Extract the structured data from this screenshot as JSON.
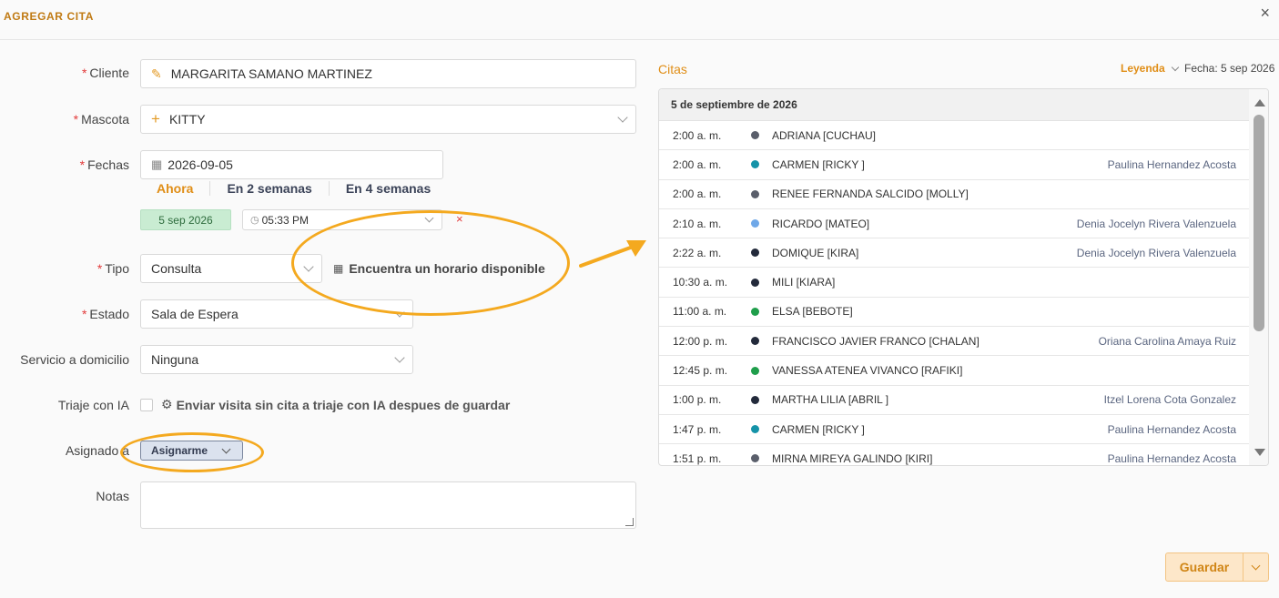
{
  "dialog": {
    "title": "AGREGAR CITA",
    "close_glyph": "×"
  },
  "form": {
    "cliente": {
      "label": "Cliente",
      "required": "*",
      "value": "MARGARITA SAMANO MARTINEZ",
      "icon": "edit-icon"
    },
    "mascota": {
      "label": "Mascota",
      "required": "*",
      "value": "KITTY",
      "icon": "plus-icon"
    },
    "fechas": {
      "label": "Fechas",
      "required": "*",
      "value": "2026-09-05",
      "quick": [
        "Ahora",
        "En 2 semanas",
        "En 4 semanas"
      ],
      "date_badge": "5 sep 2026",
      "time": "05:33 PM",
      "clear": "×"
    },
    "tipo": {
      "label": "Tipo",
      "required": "*",
      "value": "Consulta",
      "find_slot": "Encuentra un horario disponible"
    },
    "estado": {
      "label": "Estado",
      "required": "*",
      "value": "Sala de Espera"
    },
    "servicio": {
      "label": "Servicio a domicilio",
      "value": "Ninguna"
    },
    "triaje": {
      "label": "Triaje con IA",
      "checkbox_text": "Enviar visita sin cita a triaje con IA despues de guardar",
      "checked": false
    },
    "asignado": {
      "label": "Asignado a",
      "button": "Asignarme"
    },
    "notas": {
      "label": "Notas",
      "value": ""
    }
  },
  "citas": {
    "title": "Citas",
    "legend": "Leyenda",
    "fecha": "Fecha: 5 sep 2026",
    "day_header": "5 de septiembre de 2026",
    "rows": [
      {
        "time": "2:00 a. m.",
        "name": "ADRIANA [CUCHAU]",
        "vet": "",
        "color": "#5a5f6b"
      },
      {
        "time": "2:00 a. m.",
        "name": "CARMEN [RICKY ]",
        "vet": "Paulina Hernandez Acosta",
        "color": "#1593a8"
      },
      {
        "time": "2:00 a. m.",
        "name": "RENEE FERNANDA SALCIDO [MOLLY]",
        "vet": "",
        "color": "#5a5f6b"
      },
      {
        "time": "2:10 a. m.",
        "name": "RICARDO [MATEO]",
        "vet": "Denia Jocelyn Rivera Valenzuela",
        "color": "#6fa8e8"
      },
      {
        "time": "2:22 a. m.",
        "name": "DOMIQUE [KIRA]",
        "vet": "Denia Jocelyn Rivera Valenzuela",
        "color": "#232a3b"
      },
      {
        "time": "10:30 a. m.",
        "name": "MILI [KIARA]",
        "vet": "",
        "color": "#232a3b"
      },
      {
        "time": "11:00 a. m.",
        "name": "ELSA [BEBOTE]",
        "vet": "",
        "color": "#1f9e4b"
      },
      {
        "time": "12:00 p. m.",
        "name": "FRANCISCO JAVIER FRANCO [CHALAN]",
        "vet": "Oriana Carolina Amaya Ruiz",
        "color": "#232a3b"
      },
      {
        "time": "12:45 p. m.",
        "name": "VANESSA ATENEA VIVANCO [RAFIKI]",
        "vet": "",
        "color": "#1f9e4b"
      },
      {
        "time": "1:00 p. m.",
        "name": "MARTHA LILIA [ABRIL ]",
        "vet": "Itzel Lorena Cota Gonzalez",
        "color": "#232a3b"
      },
      {
        "time": "1:47 p. m.",
        "name": "CARMEN [RICKY ]",
        "vet": "Paulina Hernandez Acosta",
        "color": "#1593a8"
      },
      {
        "time": "1:51 p. m.",
        "name": "MIRNA MIREYA GALINDO [KIRI]",
        "vet": "Paulina Hernandez Acosta",
        "color": "#5a5f6b"
      }
    ]
  },
  "footer": {
    "save": "Guardar"
  },
  "colors": {
    "accent": "#e08e17",
    "annotation": "#f4a91f",
    "required": "#e23b3b"
  }
}
